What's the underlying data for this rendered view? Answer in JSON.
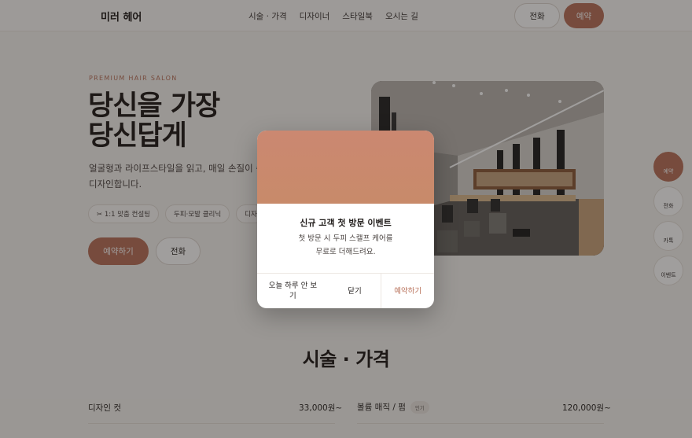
{
  "header": {
    "logo": "미러 헤어",
    "nav": [
      "시술 · 가격",
      "디자이너",
      "스타일북",
      "오시는 길"
    ],
    "call_label": "전화",
    "book_label": "예약"
  },
  "hero": {
    "eyebrow": "PREMIUM HAIR SALON",
    "title_line1": "당신을 가장",
    "title_line2": "당신답게",
    "desc_line1": "얼굴형과 라이프스타일을 읽고, 매일 손질이 쉬",
    "desc_line2": "디자인합니다.",
    "chips": [
      "✂ 1:1 맞춤 컨설팅",
      "두피·모발 클리닉",
      "디자"
    ],
    "book_label": "예약하기",
    "call_label": "전화"
  },
  "side_buttons": [
    "예약",
    "전화",
    "카톡",
    "이벤트"
  ],
  "services": {
    "title": "시술 · 가격",
    "left": {
      "name": "디자인 컷",
      "price": "33,000원~"
    },
    "right": {
      "name": "볼륨 매직 / 펌",
      "tag": "인기",
      "price": "120,000원~"
    }
  },
  "modal": {
    "title": "신규 고객 첫 방문 이벤트",
    "body_line1": "첫 방문 시 두피 스캘프 케어를",
    "body_line2": "무료로 더해드려요.",
    "dismiss_today": "오늘 하루 안 보기",
    "close": "닫기",
    "book": "예약하기"
  },
  "colors": {
    "accent": "#b8715a",
    "banner": "#cb8871"
  }
}
